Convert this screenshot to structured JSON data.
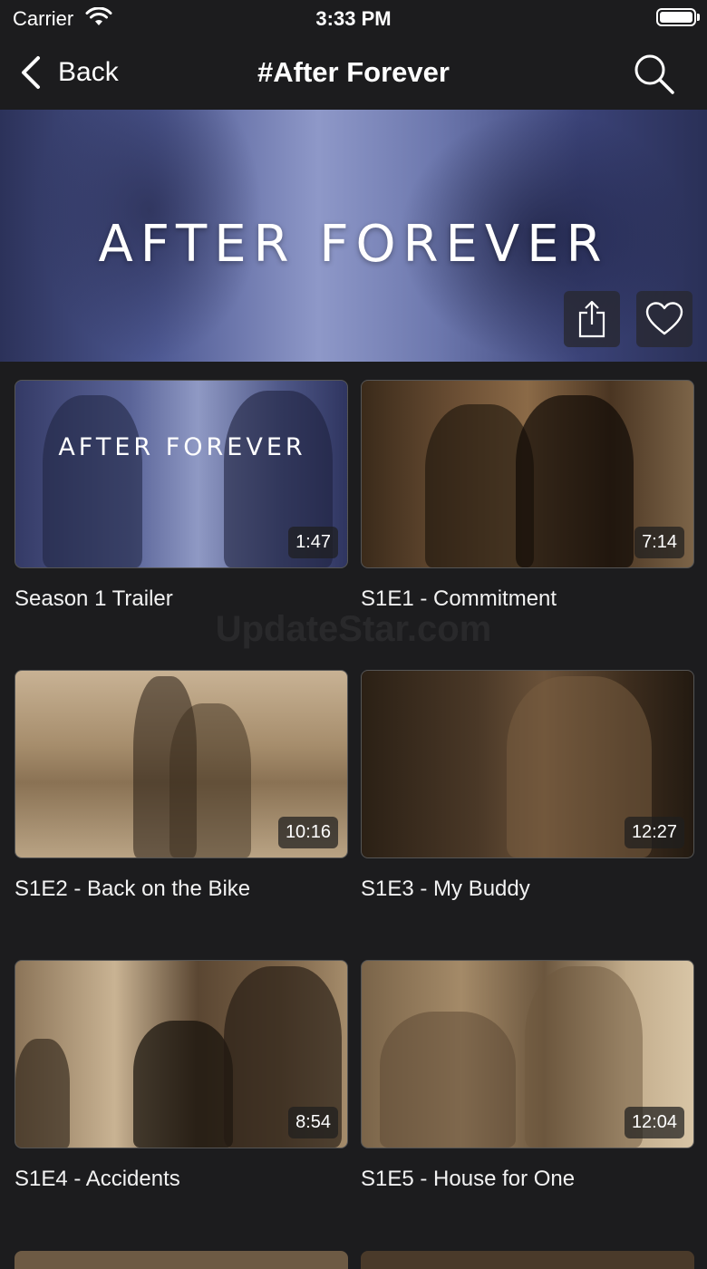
{
  "status_bar": {
    "carrier": "Carrier",
    "time": "3:33 PM",
    "icons": [
      "wifi-icon",
      "battery-icon"
    ]
  },
  "nav": {
    "back_label": "Back",
    "title": "#After Forever",
    "icons": [
      "chevron-left-icon",
      "search-icon"
    ]
  },
  "hero": {
    "title": "AFTER FOREVER",
    "icons": [
      "share-icon",
      "heart-icon"
    ],
    "tint": "#5b6599"
  },
  "watermark": "UpdateStar.com",
  "episodes": [
    {
      "title": "Season 1 Trailer",
      "duration": "1:47",
      "thumb_caption": "AFTER FOREVER",
      "tone": "blue"
    },
    {
      "title": "S1E1 - Commitment",
      "duration": "7:14",
      "tone": "sepia"
    },
    {
      "title": "S1E2 - Back on the Bike",
      "duration": "10:16",
      "tone": "sepia"
    },
    {
      "title": "S1E3 - My Buddy",
      "duration": "12:27",
      "tone": "sepia"
    },
    {
      "title": "S1E4 - Accidents",
      "duration": "8:54",
      "tone": "sepia"
    },
    {
      "title": "S1E5 - House for One",
      "duration": "12:04",
      "tone": "sepia"
    }
  ],
  "colors": {
    "background": "#1c1c1e",
    "text": "#ffffff"
  }
}
